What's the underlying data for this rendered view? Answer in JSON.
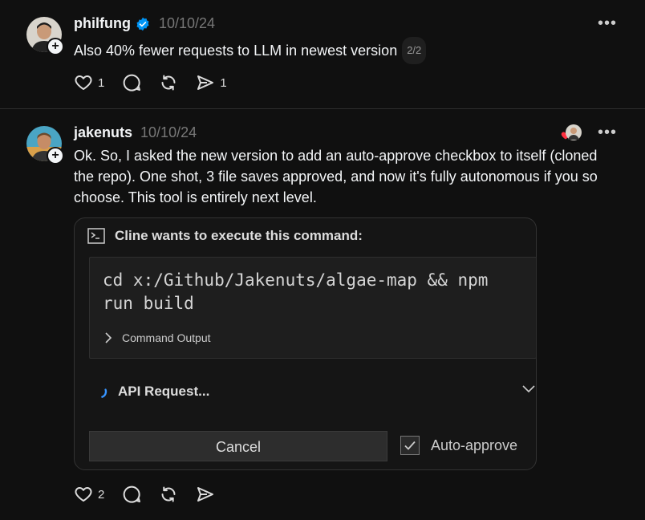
{
  "posts": [
    {
      "username": "philfung",
      "verified": true,
      "timestamp": "10/10/24",
      "text": "Also 40% fewer requests to LLM in newest version",
      "thread_badge": "2/2",
      "likes": "1",
      "reposts": "",
      "shares": "1"
    },
    {
      "username": "jakenuts",
      "timestamp": "10/10/24",
      "text_lines": [
        "Ok. So, I asked the new version to add an auto-approve checkbox to itself (cloned",
        "the repo). One shot, 3 file saves approved, and now it's fully autonomous if you so",
        "choose. This tool is entirely next level."
      ],
      "likes": "2",
      "card": {
        "title": "Cline wants to execute this command:",
        "command_lines": [
          "cd x:/Github/Jakenuts/algae-map && npm",
          "run build"
        ],
        "command_output_label": "Command Output",
        "api_request_label": "API Request...",
        "cancel_label": "Cancel",
        "auto_approve_label": "Auto-approve",
        "auto_approve_checked": true
      }
    }
  ],
  "more_label": "•••",
  "colors": {
    "background": "#101010",
    "text": "#f3f5f7",
    "muted": "#777777",
    "verified": "#0095f6",
    "spinner": "#3794ff",
    "liked_heart": "#ff3040"
  }
}
